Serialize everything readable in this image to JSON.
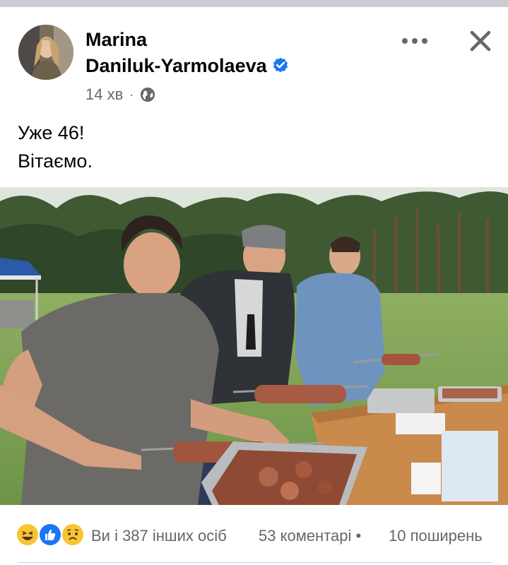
{
  "post": {
    "author_line1": "Marina",
    "author_line2": "Daniluk-Yarmolaeva",
    "verified": true,
    "time": "14 хв",
    "privacy_icon": "globe-icon",
    "text_line1": "Уже 46!",
    "text_line2": "Вітаємо."
  },
  "actions": {
    "more_icon": "more-icon",
    "close_icon": "close-icon"
  },
  "engagement": {
    "reaction_icons": [
      "haha-reaction-icon",
      "like-reaction-icon",
      "sad-reaction-icon"
    ],
    "reactions_text": "Ви і 387 інших осіб",
    "comments_text": "53 коментарі",
    "separator": "•",
    "shares_text": "10 поширень"
  },
  "colors": {
    "verified_blue": "#1877f2",
    "secondary_text": "#65676b",
    "like_blue": "#1877f2",
    "emoji_yellow": "#f7c531"
  }
}
